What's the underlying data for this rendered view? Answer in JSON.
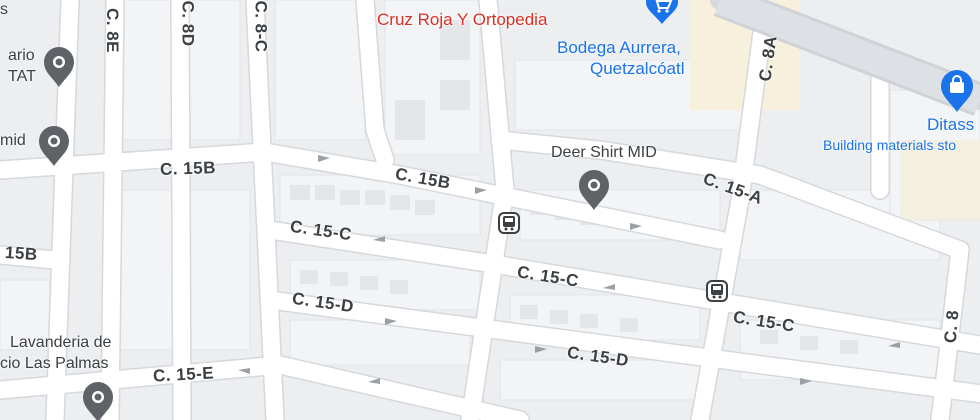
{
  "streets": {
    "c15b_left": "C. 15B",
    "c15b_mid": "C. 15B",
    "c15b_far_left": "15B",
    "c15a": "C. 15-A",
    "c15c_left": "C. 15-C",
    "c15c_mid": "C. 15-C",
    "c15c_right": "C. 15-C",
    "c15d_left": "C. 15-D",
    "c15d_mid": "C. 15-D",
    "c15e": "C. 15-E",
    "c8e": "C. 8E",
    "c8d": "C. 8D",
    "c8c": "C. 8-C",
    "c8a": "C. 8A",
    "c8": "C. 8"
  },
  "places": {
    "cruz_roja": "Cruz Roja Y Ortopedia",
    "bodega_line1": "Bodega Aurrera,",
    "bodega_line2": "Quetzalcóatl",
    "deer_shirt": "Deer Shirt MID",
    "ditass": "Ditass",
    "ditass_sub": "Building materials sto",
    "lavanderia_line1": "Lavanderia de",
    "lavanderia_line2": "cio Las Palmas",
    "left_top_1": "ario",
    "left_top_2": "TAT",
    "left_mid": "mid",
    "left_s": "s"
  },
  "icons": {
    "shopping_cart": "shopping-cart-icon",
    "store_bag": "shopping-bag-icon",
    "pin": "map-pin-icon",
    "bus": "bus-stop-icon"
  },
  "colors": {
    "land": "#e8eaed",
    "road": "#ffffff",
    "road_edge": "#dadce0",
    "block": "#f1f3f4",
    "building": "#dfe1e5",
    "poi_blue": "#1a73e8",
    "poi_red": "#d93025",
    "pin_gray": "#5f6368"
  }
}
